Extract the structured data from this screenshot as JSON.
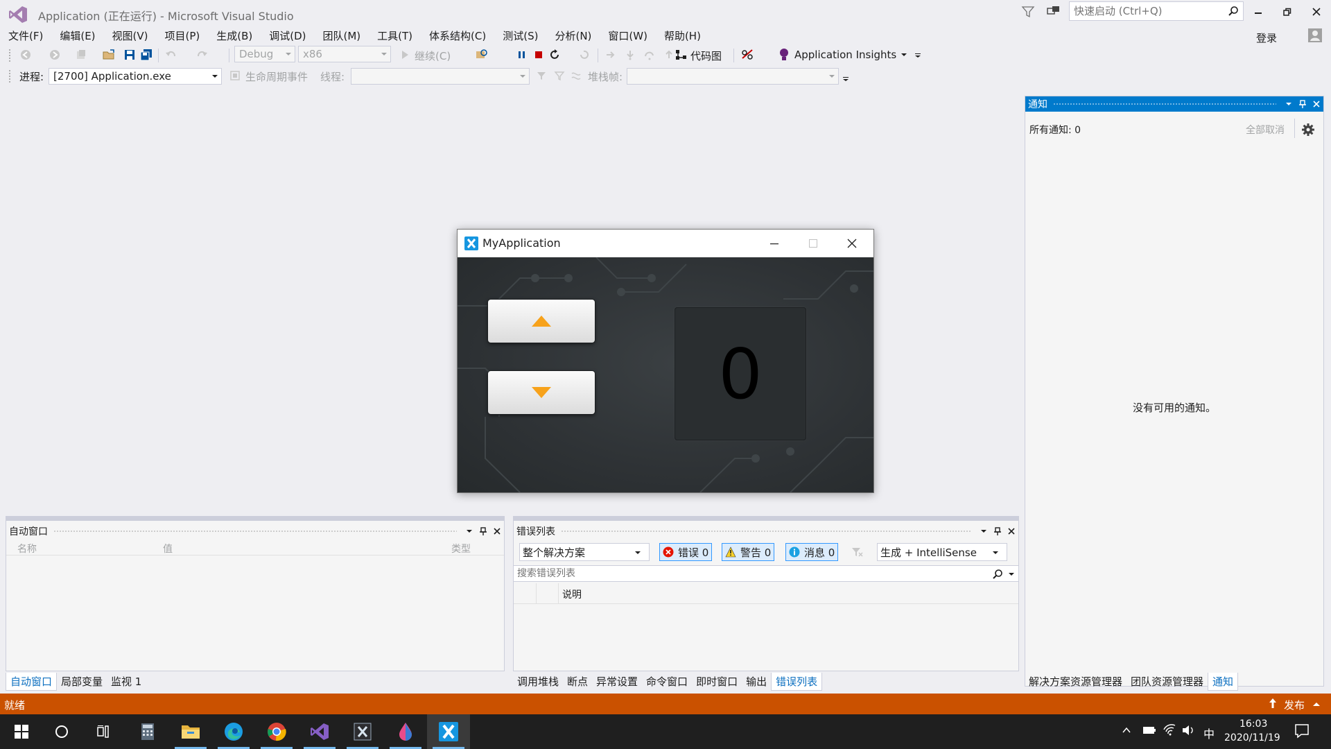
{
  "window": {
    "title": "Application (正在运行) - Microsoft Visual Studio",
    "quick_launch_placeholder": "快速启动 (Ctrl+Q)",
    "login_label": "登录"
  },
  "menu": [
    "文件(F)",
    "编辑(E)",
    "视图(V)",
    "项目(P)",
    "生成(B)",
    "调试(D)",
    "团队(M)",
    "工具(T)",
    "体系结构(C)",
    "测试(S)",
    "分析(N)",
    "窗口(W)",
    "帮助(H)"
  ],
  "toolbar": {
    "config": "Debug",
    "platform": "x86",
    "continue_label": "继续(C)",
    "code_map_label": "代码图",
    "app_insights_label": "Application Insights",
    "process_label": "进程:",
    "process_value": "[2700] Application.exe",
    "lifecycle_label": "生命周期事件",
    "thread_label": "线程:",
    "stackframe_label": "堆栈帧:"
  },
  "notifications": {
    "title": "通知",
    "count_label": "所有通知: 0",
    "dismiss_all": "全部取消",
    "empty_message": "没有可用的通知。"
  },
  "app_window": {
    "title": "MyApplication",
    "display_value": "0"
  },
  "autos": {
    "title": "自动窗口",
    "columns": [
      "名称",
      "值",
      "类型"
    ],
    "tabs": [
      "自动窗口",
      "局部变量",
      "监视 1"
    ]
  },
  "error_list": {
    "title": "错误列表",
    "scope": "整个解决方案",
    "errors": "错误 0",
    "warnings": "警告 0",
    "messages": "消息 0",
    "build_filter": "生成 + IntelliSense",
    "search_placeholder": "搜索错误列表",
    "column_description": "说明",
    "tabs": [
      "调用堆栈",
      "断点",
      "异常设置",
      "命令窗口",
      "即时窗口",
      "输出",
      "错误列表"
    ]
  },
  "right_tabs": [
    "解决方案资源管理器",
    "团队资源管理器",
    "通知"
  ],
  "status": {
    "text": "就绪",
    "publish": "发布"
  },
  "taskbar": {
    "ime": "中",
    "time": "16:03",
    "date": "2020/11/19"
  },
  "colors": {
    "accent": "#007acc",
    "statusbar": "#ca5100",
    "arrow": "#f7a21b"
  }
}
